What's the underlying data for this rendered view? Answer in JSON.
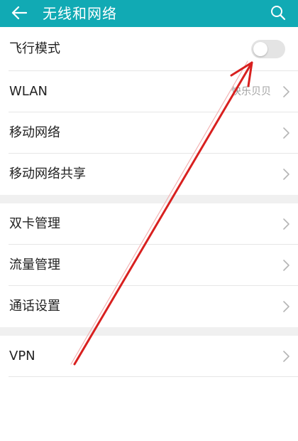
{
  "header": {
    "title": "无线和网络",
    "back_icon": "arrow-left-icon",
    "search_icon": "search-icon"
  },
  "colors": {
    "header_bg": "#11aab4",
    "header_text": "#ffffff",
    "divider": "#e6e6e6",
    "section_gap": "#f0f0f0",
    "annotation_arrow": "#d8201f"
  },
  "settings": {
    "section1": {
      "airplane_mode": {
        "label": "飞行模式",
        "enabled": false
      },
      "wlan": {
        "label": "WLAN",
        "value": "快乐贝贝"
      },
      "mobile_network": {
        "label": "移动网络"
      },
      "tethering": {
        "label": "移动网络共享"
      }
    },
    "section2": {
      "dual_sim": {
        "label": "双卡管理"
      },
      "data_usage": {
        "label": "流量管理"
      },
      "call_settings": {
        "label": "通话设置"
      }
    },
    "section3": {
      "vpn": {
        "label": "VPN"
      }
    }
  }
}
